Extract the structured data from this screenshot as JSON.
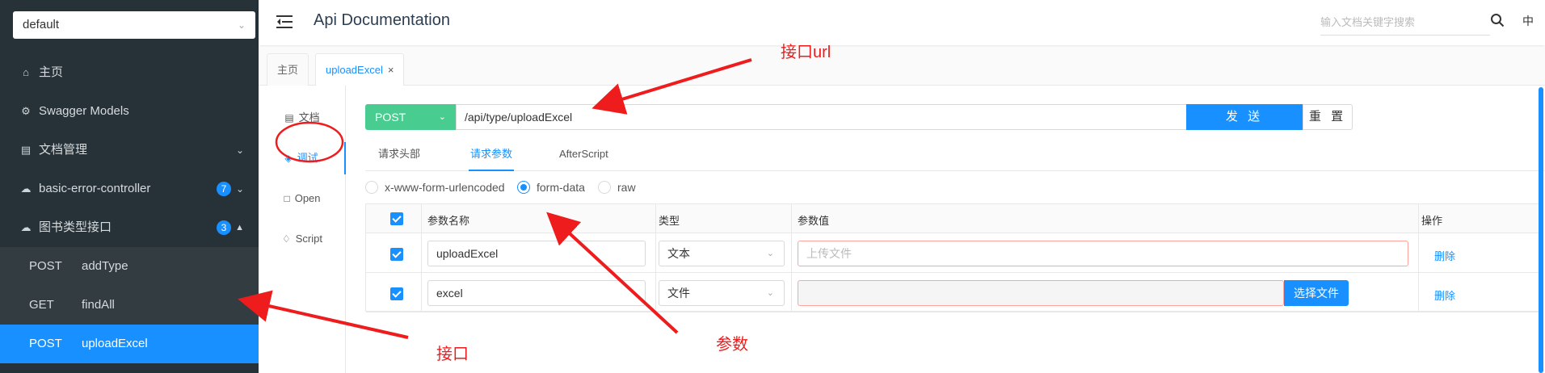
{
  "sidebar": {
    "group_select": {
      "value": "default"
    },
    "items": [
      {
        "label": "主页",
        "icon": "home-icon"
      },
      {
        "label": "Swagger Models",
        "icon": "gear-icon"
      },
      {
        "label": "文档管理",
        "icon": "document-icon"
      },
      {
        "label": "basic-error-controller",
        "icon": "cloud-icon",
        "badge": "7"
      },
      {
        "label": "图书类型接口",
        "icon": "cloud-icon",
        "badge": "3"
      }
    ],
    "apis": [
      {
        "method": "POST",
        "path": "addType"
      },
      {
        "method": "GET",
        "path": "findAll"
      },
      {
        "method": "POST",
        "path": "uploadExcel",
        "active": true
      }
    ]
  },
  "header": {
    "title": "Api Documentation",
    "search_placeholder": "输入文档关键字搜索",
    "lang": "中"
  },
  "tabs": [
    {
      "label": "主页"
    },
    {
      "label": "uploadExcel",
      "close": "×",
      "active": true
    }
  ],
  "left_menu": [
    {
      "label": "文档",
      "icon": "document-icon"
    },
    {
      "label": "调试",
      "icon": "bug-icon",
      "active": true
    },
    {
      "label": "Open",
      "icon": "file-icon"
    },
    {
      "label": "Script",
      "icon": "code-icon"
    }
  ],
  "request": {
    "method": "POST",
    "url": "/api/type/uploadExcel",
    "send_label": "发 送",
    "reset_label": "重 置"
  },
  "param_tabs": [
    {
      "label": "请求头部"
    },
    {
      "label": "请求参数",
      "active": true
    },
    {
      "label": "AfterScript"
    }
  ],
  "body_types": [
    {
      "label": "x-www-form-urlencoded",
      "checked": false
    },
    {
      "label": "form-data",
      "checked": true
    },
    {
      "label": "raw",
      "checked": false
    }
  ],
  "table": {
    "headers": {
      "name": "参数名称",
      "type": "类型",
      "value": "参数值",
      "op": "操作"
    },
    "rows": [
      {
        "name": "uploadExcel",
        "type": "文本",
        "value_placeholder": "上传文件",
        "action": "删除",
        "checked": true
      },
      {
        "name": "excel",
        "type": "文件",
        "value_placeholder": "",
        "pick_label": "选择文件",
        "action": "删除",
        "checked": true
      }
    ]
  },
  "annotations": {
    "url_note": "接口url",
    "api_note": "接口",
    "params_note": "参数"
  },
  "colors": {
    "sidebar_bg": "#263238",
    "accent": "#1890ff",
    "post_green": "#49cc90",
    "annotation_red": "#ee1c1c"
  }
}
